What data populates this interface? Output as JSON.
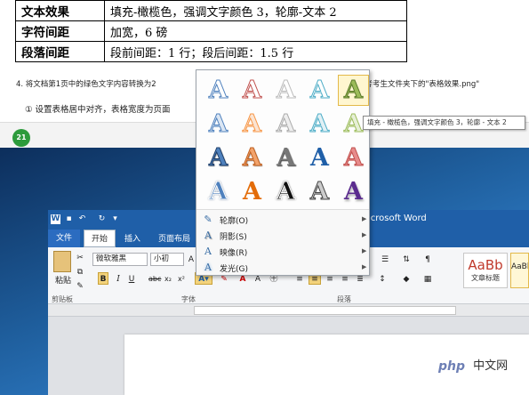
{
  "doc": {
    "table": [
      {
        "key": "文本效果",
        "val": "填充-橄榄色，强调文字颜色 3，轮廓-文本 2"
      },
      {
        "key": "字符间距",
        "val": "加宽，6 磅"
      },
      {
        "key": "段落间距",
        "val": "段前间距：1 行；段后间距：1.5 行"
      }
    ],
    "para1_left": "4. 将文档第1页中的绿色文字内容转换为2",
    "para1_right": "参考考生文件夹下的\"表格效果.png\"",
    "para2": "① 设置表格居中对齐，表格宽度为页面",
    "page_num": "21"
  },
  "word": {
    "title": "icrosoft Word",
    "tabs": {
      "file": "文件",
      "home": "开始",
      "insert": "插入",
      "layout": "页面布局"
    },
    "font_name": "微软雅黑",
    "font_size": "小初",
    "paste_label": "粘贴",
    "clipboard_group": "剪贴板",
    "font_group": "字体",
    "paragraph_group": "段落",
    "style1_preview": "AaBb",
    "style1_label": "文章标题",
    "style2_preview": "AaBb",
    "bold": "B",
    "italic": "I",
    "underline": "U"
  },
  "dropdown": {
    "letter": "A",
    "menu": [
      {
        "label": "轮廓(O)",
        "icon": "outline-icon"
      },
      {
        "label": "阴影(S)",
        "icon": "shadow-icon"
      },
      {
        "label": "映像(R)",
        "icon": "reflection-icon"
      },
      {
        "label": "发光(G)",
        "icon": "glow-icon"
      }
    ]
  },
  "tooltip": "填充 - 橄榄色，强调文字颜色 3，轮廓 - 文本 2",
  "watermark": "中文网",
  "watermark_logo": "php",
  "colors": {
    "ribbon_blue": "#1f5fa8",
    "status_green": "#2d9b3c",
    "olive": "#9bbb59"
  }
}
